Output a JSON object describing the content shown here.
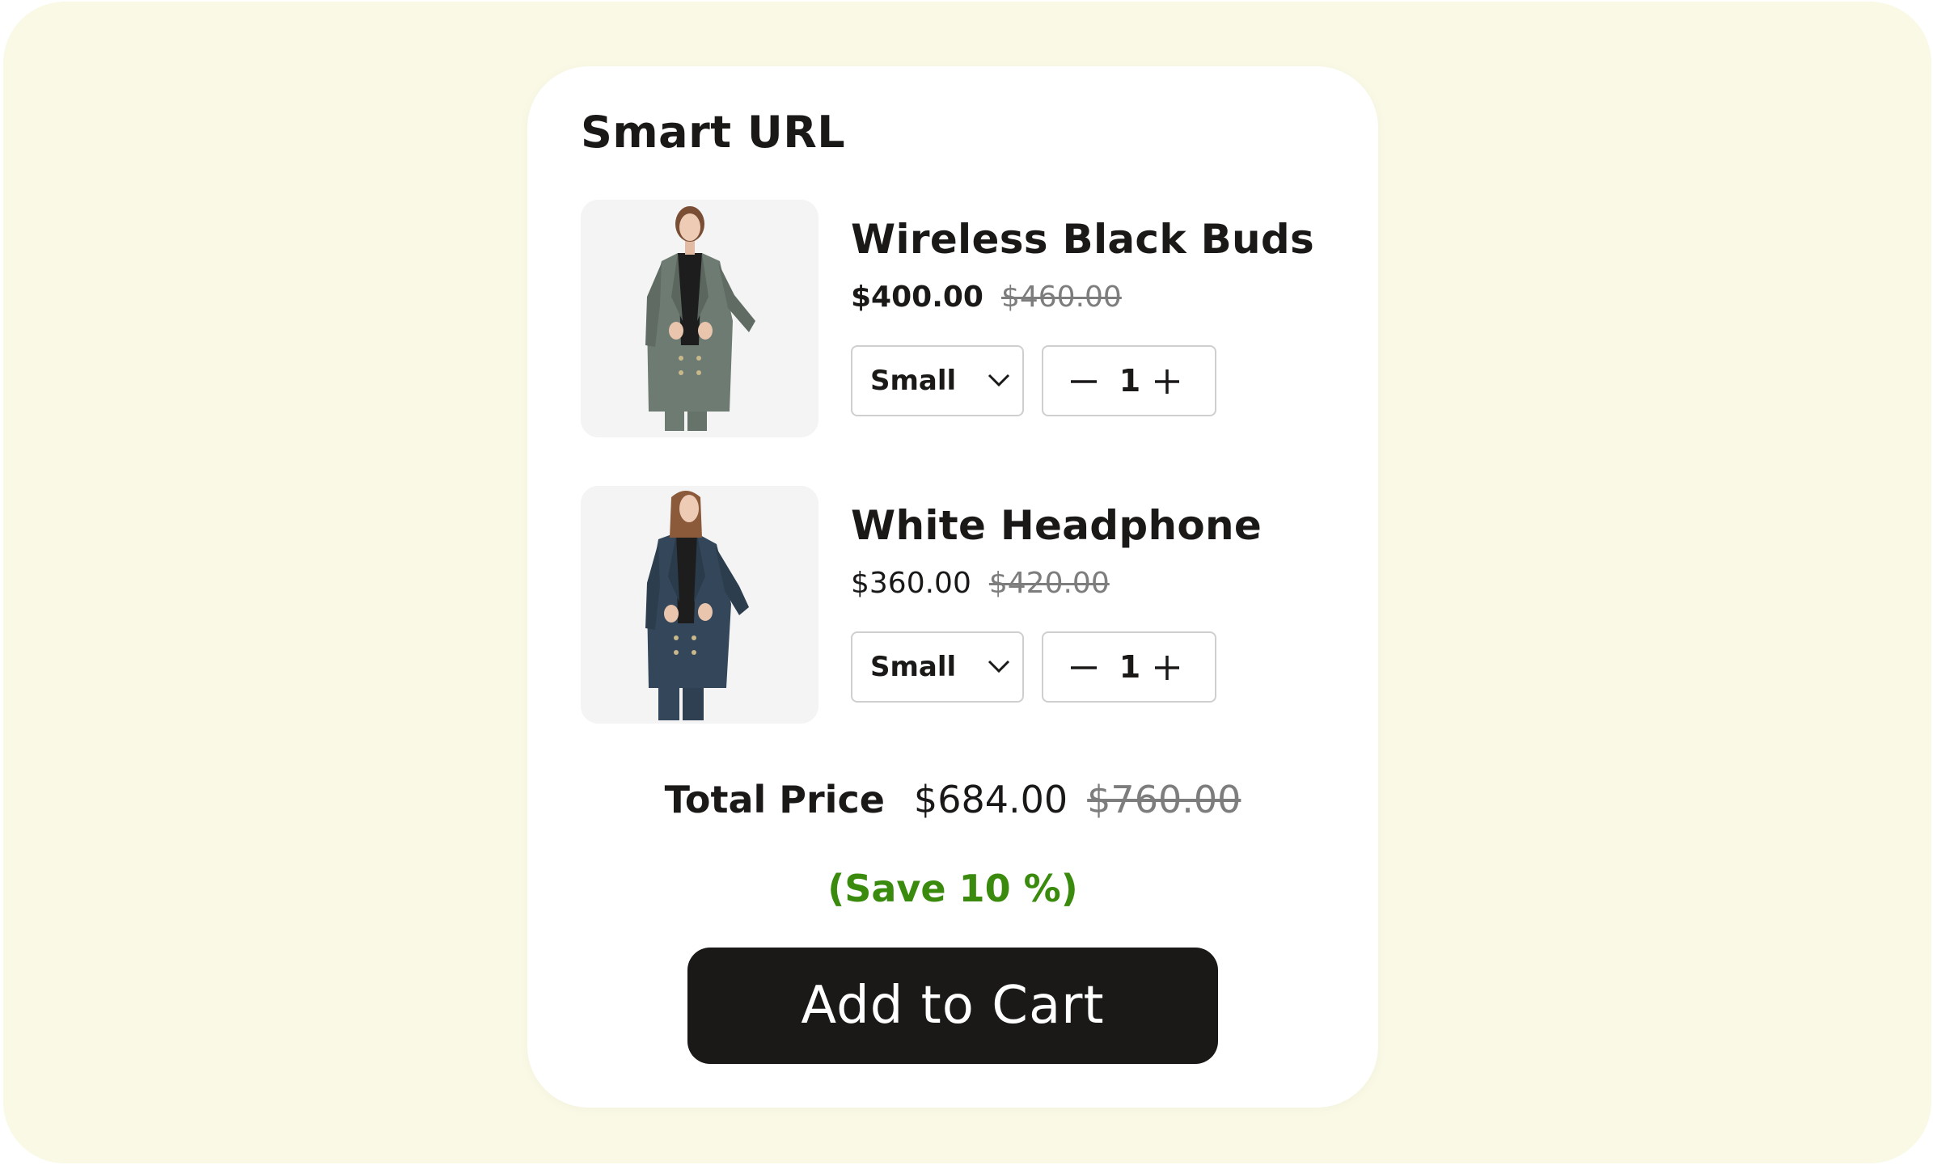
{
  "card": {
    "title": "Smart URL"
  },
  "products": [
    {
      "name": "Wireless Black Buds",
      "price": "$400.00",
      "compare_price": "$460.00",
      "size": "Small",
      "quantity": "1",
      "image_icon": "gray-blazer-model-image",
      "jacket_color": "#6e7b72"
    },
    {
      "name": "White Headphone",
      "price": "$360.00",
      "compare_price": "$420.00",
      "size": "Small",
      "quantity": "1",
      "image_icon": "navy-blazer-model-image",
      "jacket_color": "#34475a"
    }
  ],
  "total": {
    "label": "Total Price",
    "price": "$684.00",
    "compare_price": "$760.00",
    "savings": "(Save 10 %)"
  },
  "cart_button": {
    "label": "Add to Cart"
  },
  "colors": {
    "background": "#f9f9e6",
    "card": "#ffffff",
    "button": "#1b1918",
    "savings": "#3a8a0e",
    "strikethrough": "#7d7d7d"
  }
}
